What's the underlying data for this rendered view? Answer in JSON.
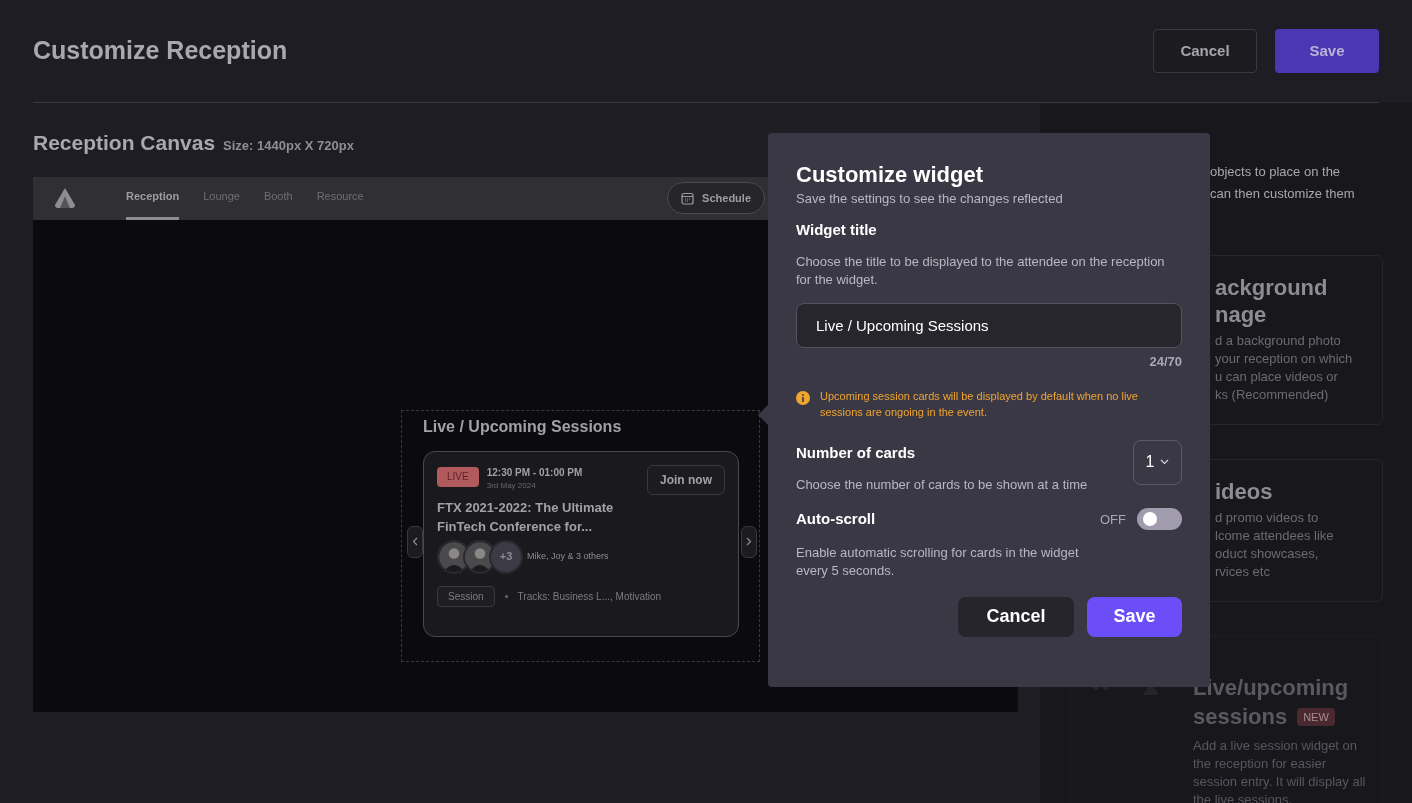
{
  "header": {
    "title": "Customize Reception",
    "buttons": [
      {
        "label": "Cancel",
        "kind": "secondary"
      },
      {
        "label": "Save",
        "kind": "primary"
      }
    ]
  },
  "canvas": {
    "title": "Reception Canvas",
    "size": "Size: 1440px X 720px",
    "nav_tabs": [
      {
        "label": "Reception",
        "selected": true
      },
      {
        "label": "Lounge",
        "selected": false
      },
      {
        "label": "Booth",
        "selected": false
      },
      {
        "label": "Resource",
        "selected": false
      }
    ],
    "schedule_button": "Schedule",
    "widget": {
      "title": "Live / Upcoming Sessions",
      "card": {
        "badge": "LIVE",
        "time": "12:30 PM - 01:00 PM",
        "date": "3rd May 2024",
        "join_button": "Join now",
        "title": "FTX 2021-2022: The Ultimate FinTech Conference for...",
        "more_count": "+3",
        "speakers": "Mike, Joy & 3 others",
        "tag": "Session",
        "tracks": "Tracks: Business L..., Motivation"
      }
    }
  },
  "side_panel": {
    "intro_lines": [
      "objects to place on the",
      "can then customize them"
    ],
    "options": [
      {
        "kind": "partial",
        "title_lines": [
          "ackground",
          "nage"
        ],
        "description_lines": [
          "d a background photo",
          "your reception on which",
          "u can place videos or",
          "ks (Recommended)"
        ]
      },
      {
        "kind": "partial",
        "title_lines": [
          "ideos"
        ],
        "description_lines": [
          "d promo videos to",
          "lcome attendees like",
          "oduct showcases,",
          "rvices etc"
        ]
      },
      {
        "kind": "full",
        "title_lines": [
          "Live/upcoming",
          "sessions"
        ],
        "badge": "NEW",
        "description": "Add a live session widget on the reception for easier session entry. It will display all the live sessions."
      }
    ]
  },
  "popover": {
    "title": "Customize widget",
    "subtitle": "Save the settings to see the changes reflected",
    "widget_title": {
      "label": "Widget title",
      "description": "Choose the title to be displayed to the attendee on the reception for the widget.",
      "value": "Live / Upcoming Sessions",
      "counter": "24/70"
    },
    "notice": "Upcoming session cards will be displayed by default when no live sessions are ongoing in the event.",
    "number_of_cards": {
      "label": "Number of cards",
      "description": "Choose the number of cards to be shown at a time",
      "value": "1"
    },
    "auto_scroll": {
      "label": "Auto-scroll",
      "description": "Enable automatic scrolling for cards in the widget every 5 seconds.",
      "state_label": "OFF",
      "on": false
    },
    "buttons": [
      {
        "label": "Cancel",
        "kind": "secondary"
      },
      {
        "label": "Save",
        "kind": "primary"
      }
    ]
  }
}
